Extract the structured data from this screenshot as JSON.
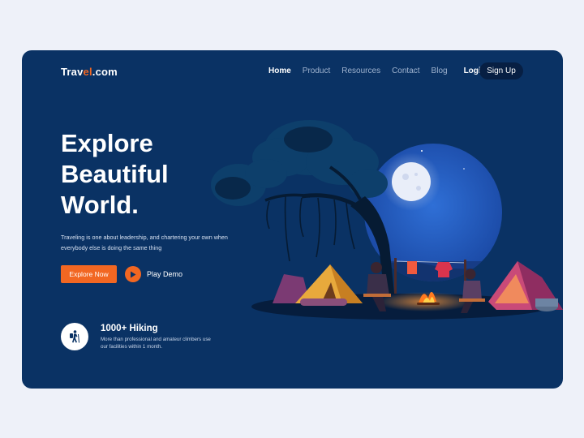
{
  "brand": {
    "name_part1": "Trav",
    "name_accent": "el",
    "name_part2": ".com"
  },
  "nav": {
    "items": [
      {
        "label": "Home",
        "active": true
      },
      {
        "label": "Product",
        "active": false
      },
      {
        "label": "Resources",
        "active": false
      },
      {
        "label": "Contact",
        "active": false
      },
      {
        "label": "Blog",
        "active": false
      }
    ],
    "login_label": "Login",
    "signup_label": "Sign Up"
  },
  "hero": {
    "title_lines": [
      "Explore",
      "Beautiful",
      "World."
    ],
    "description": "Traveling is one about leadership, and chartering your own when everybody else is doing the same thing",
    "explore_label": "Explore Now",
    "play_label": "Play Demo"
  },
  "stat": {
    "title": "1000+ Hiking",
    "description": "More than professional and amateur climbers use our facilities within 1 month.",
    "icon": "hiker-icon"
  },
  "colors": {
    "page_bg": "#eef1f9",
    "card_bg": "#0a3264",
    "accent": "#f26722",
    "signup_bg": "#071f43"
  },
  "illustration": {
    "icon": "campfire-scene-illustration"
  }
}
